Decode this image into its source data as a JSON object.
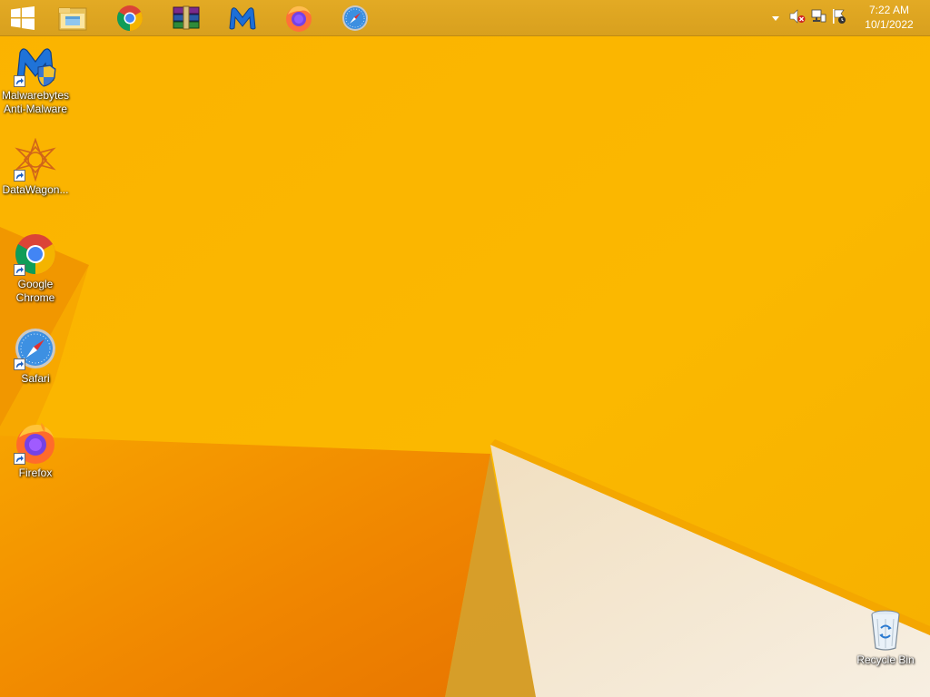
{
  "taskbar": {
    "start": {
      "icon": "windows-logo-icon"
    },
    "pinned": [
      {
        "name": "file-explorer",
        "icon": "folder-icon"
      },
      {
        "name": "google-chrome",
        "icon": "chrome-icon"
      },
      {
        "name": "winrar",
        "icon": "winrar-icon"
      },
      {
        "name": "malwarebytes",
        "icon": "malwarebytes-icon"
      },
      {
        "name": "firefox",
        "icon": "firefox-icon"
      },
      {
        "name": "safari",
        "icon": "safari-icon"
      }
    ],
    "tray": {
      "icons": [
        "chevron-up-icon",
        "speaker-muted-icon",
        "network-icon",
        "action-center-flag-icon"
      ],
      "time": "7:22 AM",
      "date": "10/1/2022"
    }
  },
  "desktop": {
    "icons": [
      {
        "label": "Malwarebytes\nAnti-Malware",
        "line1": "Malwarebytes",
        "line2": "Anti-Malware",
        "icon": "malwarebytes-icon"
      },
      {
        "label": "DataWagon...",
        "line1": "DataWagon...",
        "line2": "",
        "icon": "datawagon-icon"
      },
      {
        "label": "Google Chrome",
        "line1": "Google",
        "line2": "Chrome",
        "icon": "chrome-icon"
      },
      {
        "label": "Safari",
        "line1": "Safari",
        "line2": "",
        "icon": "safari-icon"
      },
      {
        "label": "Firefox",
        "line1": "Firefox",
        "line2": "",
        "icon": "firefox-icon"
      },
      {
        "label": "Recycle Bin",
        "line1": "Recycle Bin",
        "line2": "",
        "icon": "recycle-bin-icon"
      }
    ]
  },
  "colors": {
    "wallpaper_yellow": "#f9b400",
    "wallpaper_orange": "#f08a00",
    "wallpaper_white": "#f3e4cc",
    "taskbar": "#dba422"
  }
}
